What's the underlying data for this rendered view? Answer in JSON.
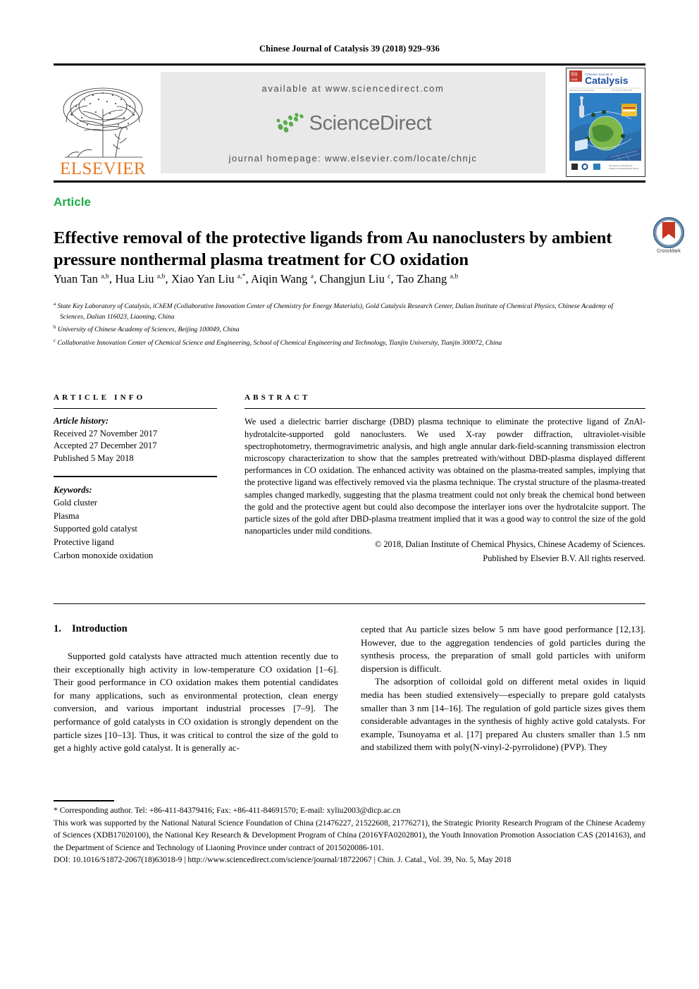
{
  "running_head": "Chinese Journal of Catalysis 39 (2018) 929–936",
  "masthead": {
    "publisher_name": "ELSEVIER",
    "available_at": "available at www.sciencedirect.com",
    "sciencedirect_word": "ScienceDirect",
    "journal_homepage": "journal homepage: www.elsevier.com/locate/chnjc",
    "cover_journal_line1": "Chinese Journal of",
    "cover_journal_line2": "Catalysis"
  },
  "article": {
    "kind": "Article",
    "title": "Effective removal of the protective ligands from Au nanoclusters by ambient pressure nonthermal plasma treatment for CO oxidation",
    "crossmark_label": "CrossMark",
    "authors": [
      {
        "name": "Yuan Tan",
        "sup": "a,b",
        "sep": ", "
      },
      {
        "name": "Hua Liu",
        "sup": "a,b",
        "sep": ", "
      },
      {
        "name": "Xiao Yan Liu",
        "sup": "a,*",
        "sep": ", "
      },
      {
        "name": "Aiqin Wang",
        "sup": "a",
        "sep": ", "
      },
      {
        "name": "Changjun Liu",
        "sup": "c",
        "sep": ", "
      },
      {
        "name": "Tao Zhang",
        "sup": "a,b",
        "sep": ""
      }
    ],
    "affiliations": [
      {
        "marker": "a",
        "text": "State Key Laboratory of Catalysis, iChEM (Collaborative Innovation Center of Chemistry for Energy Materials), Gold Catalysis Research Center, Dalian Institute of Chemical Physics, Chinese Academy of Sciences, Dalian 116023, Liaoning, China"
      },
      {
        "marker": "b",
        "text": "University of Chinese Academy of Sciences, Beijing 100049, China"
      },
      {
        "marker": "c",
        "text": "Collaborative Innovation Center of Chemical Science and Engineering, School of Chemical Engineering and Technology, Tianjin University, Tianjin 300072, China"
      }
    ]
  },
  "info": {
    "heading": "ARTICLE INFO",
    "history_label": "Article history:",
    "history": [
      "Received 27 November 2017",
      "Accepted 27 December 2017",
      "Published 5 May 2018"
    ],
    "keywords_label": "Keywords:",
    "keywords": [
      "Gold cluster",
      "Plasma",
      "Supported gold catalyst",
      "Protective ligand",
      "Carbon monoxide oxidation"
    ]
  },
  "abstract": {
    "heading": "ABSTRACT",
    "text": "We used a dielectric barrier discharge (DBD) plasma technique to eliminate the protective ligand of ZnAl-hydrotalcite-supported gold nanoclusters. We used X-ray powder diffraction, ultraviolet-visible spectrophotometry, thermogravimetric analysis, and high angle annular dark-field-scanning transmission electron microscopy characterization to show that the samples pretreated with/without DBD-plasma displayed different performances in CO oxidation. The enhanced activity was obtained on the plasma-treated samples, implying that the protective ligand was effectively removed via the plasma technique. The crystal structure of the plasma-treated samples changed markedly, suggesting that the plasma treatment could not only break the chemical bond between the gold and the protective agent but could also decompose the interlayer ions over the hydrotalcite support. The particle sizes of the gold after DBD-plasma treatment implied that it was a good way to control the size of the gold nanoparticles under mild conditions.",
    "copyright_line1": "© 2018, Dalian Institute of Chemical Physics, Chinese Academy of Sciences.",
    "copyright_line2": "Published by Elsevier B.V. All rights reserved."
  },
  "body": {
    "section_number": "1.",
    "section_title": "Introduction",
    "left_paragraph": "Supported gold catalysts have attracted much attention recently due to their exceptionally high activity in low-temperature CO oxidation [1–6]. Their good performance in CO oxidation makes them potential candidates for many applications, such as environmental protection, clean energy conversion, and various important industrial processes [7–9]. The performance of gold catalysts in CO oxidation is strongly dependent on the particle sizes [10–13]. Thus, it was critical to control the size of the gold to get a highly active gold catalyst. It is generally ac-",
    "right_paragraph_1": "cepted that Au particle sizes below 5 nm have good performance [12,13]. However, due to the aggregation tendencies of gold particles during the synthesis process, the preparation of small gold particles with uniform dispersion is difficult.",
    "right_paragraph_2": "The adsorption of colloidal gold on different metal oxides in liquid media has been studied extensively—especially to prepare gold catalysts smaller than 3 nm [14–16]. The regulation of gold particle sizes gives them considerable advantages in the synthesis of highly active gold catalysts. For example, Tsunoyama et al. [17] prepared Au clusters smaller than 1.5 nm and stabilized them with poly(N-vinyl-2-pyrrolidone) (PVP). They"
  },
  "footnotes": {
    "corresponding": "* Corresponding author. Tel: +86-411-84379416; Fax: +86-411-84691570; E-mail: xyliu2003@dicp.ac.cn",
    "funding": "This work was supported by the National Natural Science Foundation of China (21476227, 21522608, 21776271), the Strategic Priority Research Program of the Chinese Academy of Sciences (XDB17020100), the National Key Research & Development Program of China (2016YFA0202801), the Youth Innovation Promotion Association CAS (2014163), and the Department of Science and Technology of Liaoning Province under contract of 2015020086-101.",
    "doi": "DOI: 10.1016/S1872-2067(18)63018-9 | http://www.sciencedirect.com/science/journal/18722067 | Chin. J. Catal., Vol. 39, No. 5, May 2018"
  },
  "colors": {
    "article_kind_green": "#1faa4b",
    "elsevier_orange": "#E87722",
    "sciencedirect_gray": "#6f7173",
    "sciencedirect_leaf_green": "#5aab4a",
    "band_background": "#e9e9e9"
  }
}
